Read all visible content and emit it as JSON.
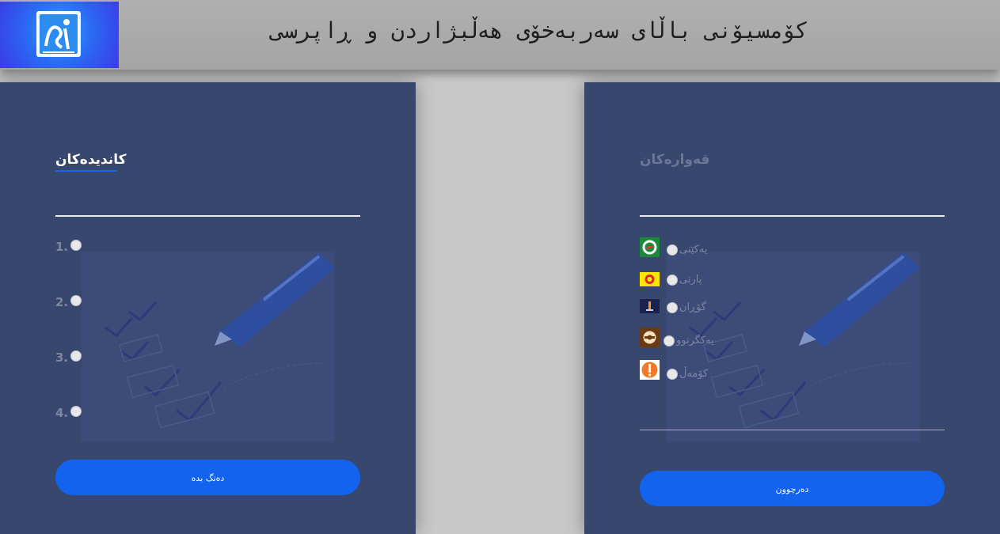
{
  "header": {
    "title": "کۆمسیۆنی باڵای سەربەخۆی هەڵبژاردن و ڕاپرسی",
    "logo_icon": "ihec-logo-icon"
  },
  "candidates": {
    "title": "کاندیدەکان",
    "items": [
      "1.",
      "2.",
      "3.",
      "4."
    ],
    "button_label": "دەنگ بدە"
  },
  "parties": {
    "title": "قەوارەکان",
    "items": [
      {
        "name": "یەکێتی",
        "logo": "puk-logo-icon"
      },
      {
        "name": "پارتی",
        "logo": "kdp-logo-icon"
      },
      {
        "name": "گۆڕان",
        "logo": "gorran-logo-icon"
      },
      {
        "name": "یەکگرتوو",
        "logo": "kiu-logo-icon"
      },
      {
        "name": "کۆمەڵ",
        "logo": "komal-logo-icon"
      }
    ],
    "button_label": "دەرچوون"
  },
  "colors": {
    "panel_bg": "#37476e",
    "accent_blue": "#1463ef",
    "header_bg": "#aaaaaa",
    "page_bg": "#c8c8c8"
  }
}
